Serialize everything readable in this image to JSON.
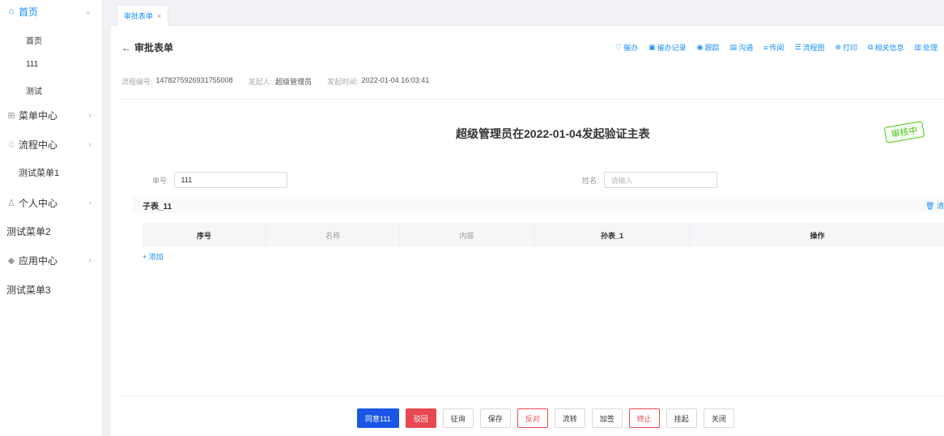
{
  "sidebar": {
    "items": [
      {
        "icon": "home-icon",
        "label": "首页",
        "expanded": true
      },
      {
        "label": "首页"
      },
      {
        "label": "111"
      },
      {
        "label": "测试"
      },
      {
        "icon": "grid-icon",
        "label": "菜单中心"
      },
      {
        "icon": "flow-icon",
        "label": "流程中心"
      },
      {
        "label": "测试菜单1"
      },
      {
        "icon": "user-icon",
        "label": "个人中心"
      },
      {
        "label": "测试菜单2"
      },
      {
        "icon": "app-icon",
        "label": "应用中心"
      },
      {
        "label": "测试菜单3"
      }
    ]
  },
  "tabs": [
    {
      "label": "审批表单",
      "close": "×"
    }
  ],
  "header": {
    "back": "←",
    "title": "审批表单"
  },
  "actions": [
    {
      "icon": "urge-icon",
      "label": "催办"
    },
    {
      "icon": "urge-record-icon",
      "label": "催办记录"
    },
    {
      "icon": "track-icon",
      "label": "跟踪"
    },
    {
      "icon": "chat-icon",
      "label": "沟通"
    },
    {
      "icon": "forward-icon",
      "label": "传阅"
    },
    {
      "icon": "flowchart-icon",
      "label": "流程图"
    },
    {
      "icon": "print-icon",
      "label": "打印"
    },
    {
      "icon": "info-icon",
      "label": "相关信息"
    },
    {
      "icon": "handle-icon",
      "label": "处理"
    }
  ],
  "meta": {
    "process_no_label": "流程编号:",
    "process_no": "1478275926931755008",
    "initiator_label": "发起人:",
    "initiator": "超级管理员",
    "time_label": "发起时间:",
    "time": "2022-01-04 16:03:41"
  },
  "form": {
    "title": "超级管理员在2022-01-04发起验证主表",
    "stamp": "审核中",
    "order_label": "单号:",
    "order_value": "111",
    "name_label": "姓名:",
    "name_placeholder": "请输入"
  },
  "subtable": {
    "title": "子表_11",
    "clear": "清",
    "columns": [
      "序号",
      "名称",
      "内容",
      "孙表_1",
      "操作"
    ],
    "add": "+ 添加"
  },
  "footer": {
    "buttons": [
      "同意111",
      "驳回",
      "征询",
      "保存",
      "反对",
      "流转",
      "加签",
      "终止",
      "挂起",
      "关闭"
    ]
  },
  "colors": {
    "accent": "#1890ff",
    "primary_button": "#1a56e5",
    "danger": "#e8484f",
    "stamp": "#52c41a"
  }
}
